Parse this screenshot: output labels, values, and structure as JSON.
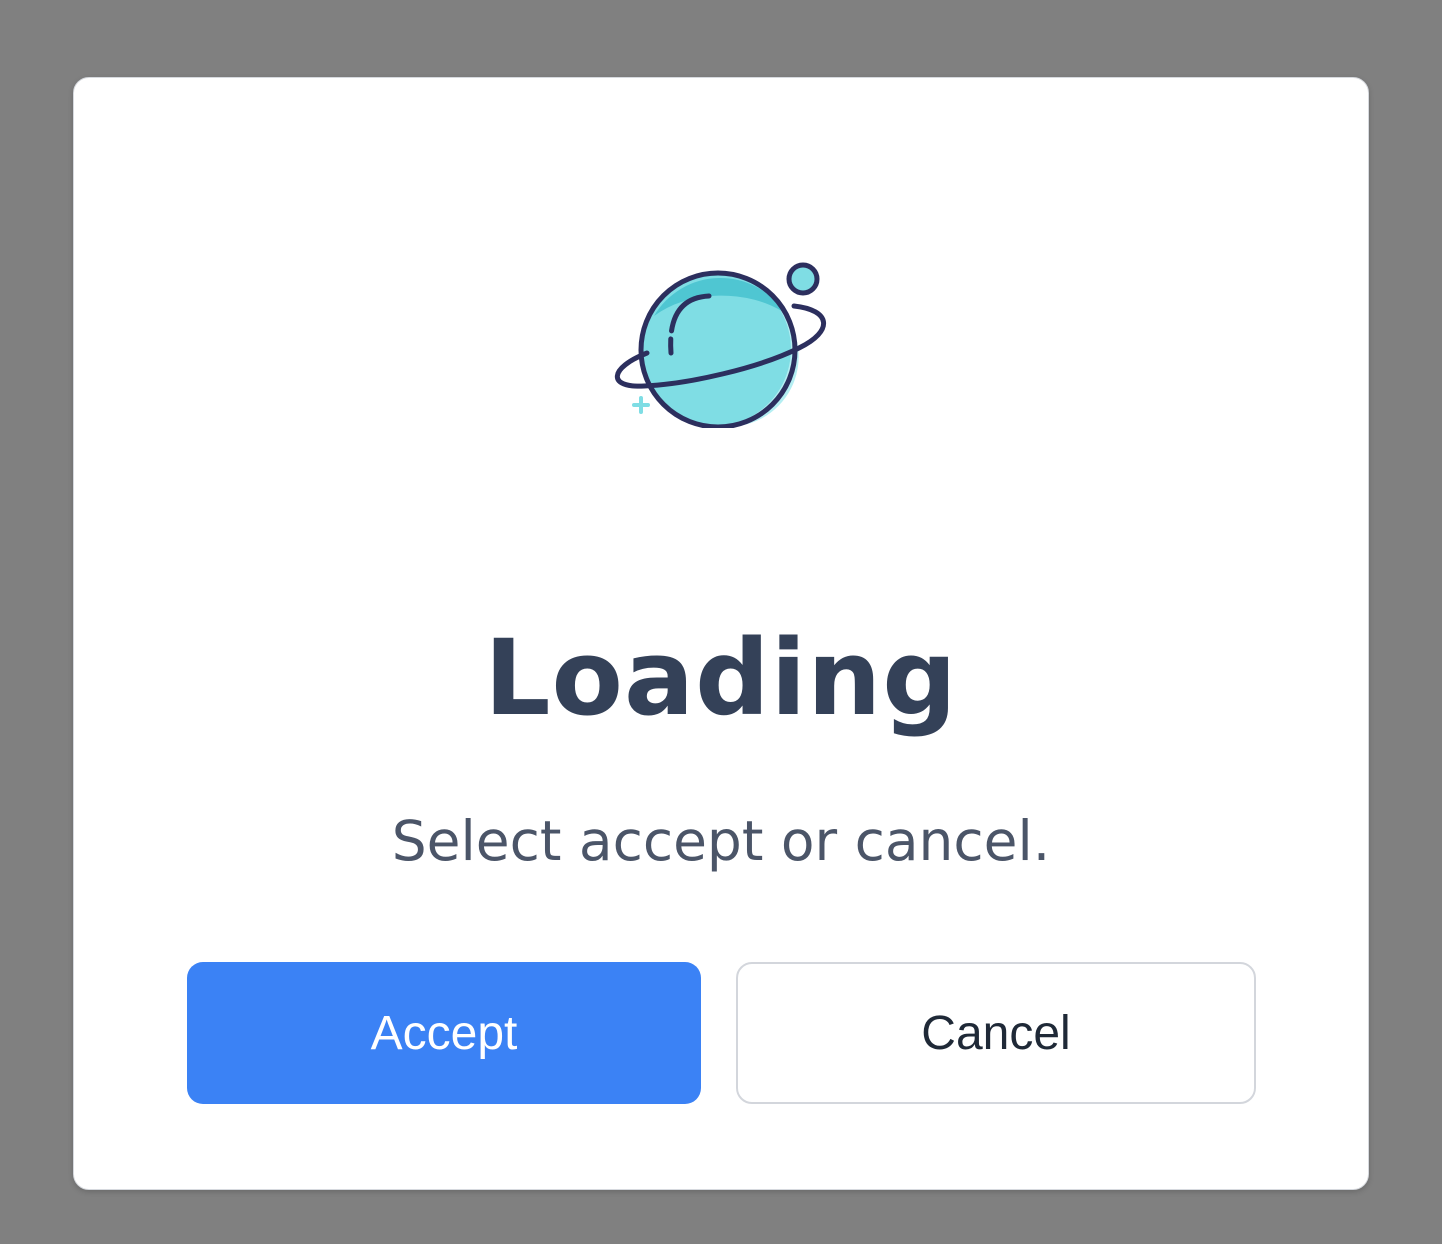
{
  "dialog": {
    "title": "Loading",
    "message": "Select accept or cancel.",
    "accept_label": "Accept",
    "cancel_label": "Cancel",
    "icon": "planet-icon"
  },
  "colors": {
    "backdrop": "#808080",
    "title": "#344158",
    "message": "#4b5568",
    "accept_bg": "#3b82f5",
    "accept_text": "#ffffff",
    "cancel_border": "#d3d6dc",
    "planet_fill": "#7fdde4",
    "planet_shade": "#4fc6d2",
    "planet_outline": "#2c2f5e"
  }
}
